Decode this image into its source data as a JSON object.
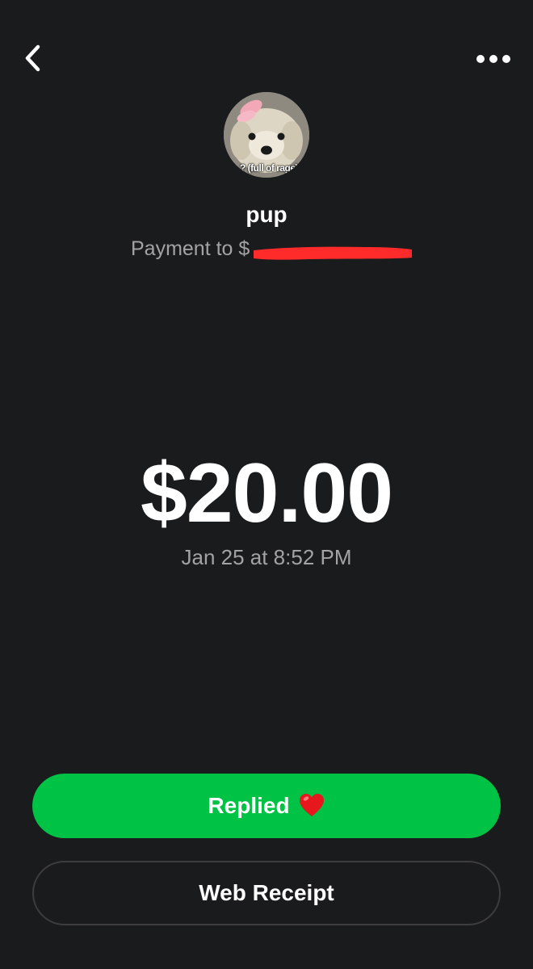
{
  "header": {
    "back_icon": "chevron-left-icon",
    "more_icon": "more-horizontal-icon"
  },
  "recipient": {
    "avatar_caption": "? (full of rage)",
    "name": "pup",
    "subtitle": "Payment to $"
  },
  "payment": {
    "amount": "$20.00",
    "timestamp": "Jan 25 at 8:52 PM"
  },
  "actions": {
    "reply_label": "Replied",
    "reply_emoji_icon": "red-heart-icon",
    "receipt_label": "Web Receipt"
  },
  "colors": {
    "background": "#1a1b1d",
    "accent_green": "#00c244",
    "muted_text": "#a3a3a3",
    "redaction_red": "#ff2a2a"
  }
}
